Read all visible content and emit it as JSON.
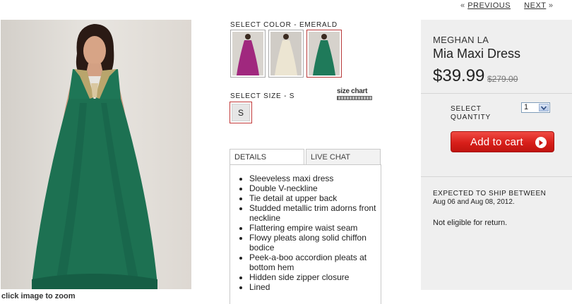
{
  "pager": {
    "previous": "PREVIOUS",
    "next": "NEXT",
    "prev_arrow": "«",
    "next_arrow": "»"
  },
  "main_image": {
    "caption": "click image to zoom"
  },
  "color": {
    "label": "SELECT COLOR - EMERALD",
    "swatches": [
      {
        "name": "magenta",
        "color": "#a0287e"
      },
      {
        "name": "ivory",
        "color": "#e9e1cc"
      },
      {
        "name": "emerald",
        "color": "#1f7a5a",
        "selected": true
      }
    ]
  },
  "size": {
    "label": "SELECT SIZE - S",
    "chart_label": "size chart",
    "options": [
      "S"
    ]
  },
  "tabs": {
    "details": "DETAILS",
    "chat": "LIVE CHAT"
  },
  "details": [
    "Sleeveless maxi dress",
    "Double V-neckline",
    "Tie detail at upper back",
    "Studded metallic trim adorns front neckline",
    "Flattering empire waist seam",
    "Flowy pleats along solid chiffon bodice",
    "Peek-a-boo accordion pleats at bottom hem",
    "Hidden side zipper closure",
    "Lined"
  ],
  "product": {
    "brand": "MEGHAN LA",
    "name": "Mia Maxi Dress",
    "price": "$39.99",
    "original_price": "$279.00"
  },
  "quantity": {
    "label": "SELECT QUANTITY",
    "value": "1"
  },
  "cart": {
    "label": "Add to cart"
  },
  "shipping": {
    "title": "EXPECTED TO SHIP BETWEEN",
    "dates": "Aug 06 and Aug 08, 2012.",
    "return_note": "Not eligible for return."
  },
  "colors": {
    "accent_red": "#d81f1a",
    "selected_border": "#b83a3a",
    "panel_bg": "#efefef",
    "dress_emerald": "#1f7a5a"
  }
}
